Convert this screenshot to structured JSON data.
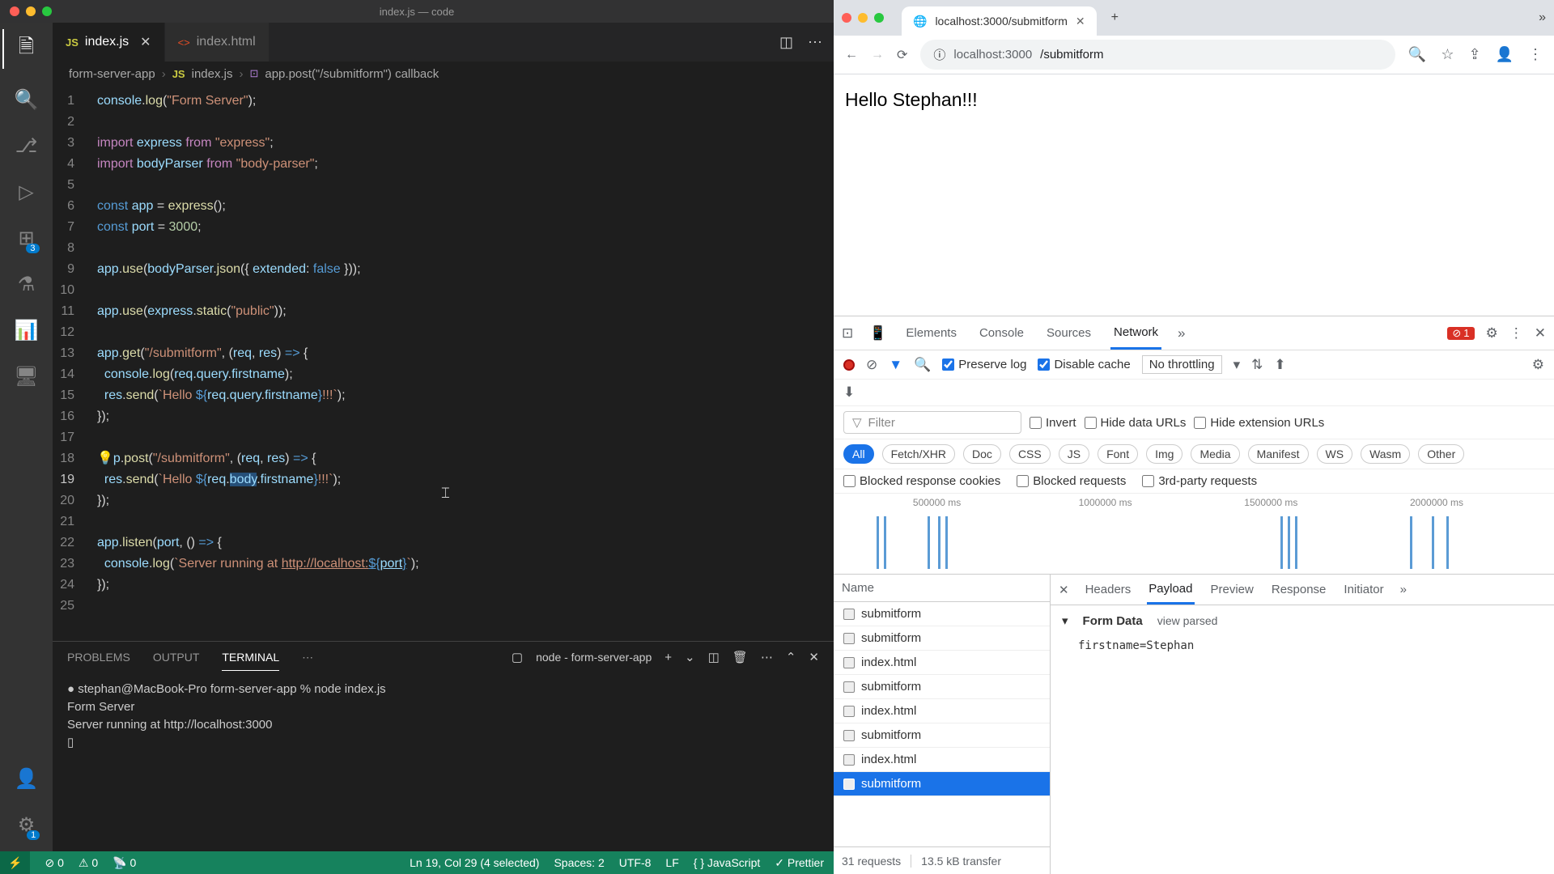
{
  "vscode": {
    "title": "index.js — code",
    "tabs": [
      {
        "icon": "JS",
        "label": "index.js",
        "active": true
      },
      {
        "icon": "<>",
        "label": "index.html",
        "active": false
      }
    ],
    "breadcrumbs": {
      "parts": [
        "form-server-app",
        "index.js",
        "app.post(\"/submitform\") callback"
      ]
    },
    "activity_badges": {
      "extensions": "3",
      "settings": "1"
    },
    "code": {
      "lines": [
        [
          {
            "t": "console",
            "c": "var"
          },
          {
            "t": ".",
            "c": "op"
          },
          {
            "t": "log",
            "c": "fn"
          },
          {
            "t": "(",
            "c": "op"
          },
          {
            "t": "\"Form Server\"",
            "c": "str"
          },
          {
            "t": ");",
            "c": "op"
          }
        ],
        [],
        [
          {
            "t": "import",
            "c": "kw"
          },
          {
            "t": " ",
            "c": ""
          },
          {
            "t": "express",
            "c": "var"
          },
          {
            "t": " ",
            "c": ""
          },
          {
            "t": "from",
            "c": "kw"
          },
          {
            "t": " ",
            "c": ""
          },
          {
            "t": "\"express\"",
            "c": "str"
          },
          {
            "t": ";",
            "c": "op"
          }
        ],
        [
          {
            "t": "import",
            "c": "kw"
          },
          {
            "t": " ",
            "c": ""
          },
          {
            "t": "bodyParser",
            "c": "var"
          },
          {
            "t": " ",
            "c": ""
          },
          {
            "t": "from",
            "c": "kw"
          },
          {
            "t": " ",
            "c": ""
          },
          {
            "t": "\"body-parser\"",
            "c": "str"
          },
          {
            "t": ";",
            "c": "op"
          }
        ],
        [],
        [
          {
            "t": "const",
            "c": "const"
          },
          {
            "t": " ",
            "c": ""
          },
          {
            "t": "app",
            "c": "prop"
          },
          {
            "t": " = ",
            "c": "op"
          },
          {
            "t": "express",
            "c": "fn"
          },
          {
            "t": "();",
            "c": "op"
          }
        ],
        [
          {
            "t": "const",
            "c": "const"
          },
          {
            "t": " ",
            "c": ""
          },
          {
            "t": "port",
            "c": "prop"
          },
          {
            "t": " = ",
            "c": "op"
          },
          {
            "t": "3000",
            "c": "num"
          },
          {
            "t": ";",
            "c": "op"
          }
        ],
        [],
        [
          {
            "t": "app",
            "c": "var"
          },
          {
            "t": ".",
            "c": "op"
          },
          {
            "t": "use",
            "c": "fn"
          },
          {
            "t": "(",
            "c": "op"
          },
          {
            "t": "bodyParser",
            "c": "var"
          },
          {
            "t": ".",
            "c": "op"
          },
          {
            "t": "json",
            "c": "fn"
          },
          {
            "t": "({ ",
            "c": "op"
          },
          {
            "t": "extended",
            "c": "var"
          },
          {
            "t": ": ",
            "c": "op"
          },
          {
            "t": "false",
            "c": "bool"
          },
          {
            "t": " }));",
            "c": "op"
          }
        ],
        [],
        [
          {
            "t": "app",
            "c": "var"
          },
          {
            "t": ".",
            "c": "op"
          },
          {
            "t": "use",
            "c": "fn"
          },
          {
            "t": "(",
            "c": "op"
          },
          {
            "t": "express",
            "c": "var"
          },
          {
            "t": ".",
            "c": "op"
          },
          {
            "t": "static",
            "c": "fn"
          },
          {
            "t": "(",
            "c": "op"
          },
          {
            "t": "\"public\"",
            "c": "str"
          },
          {
            "t": "));",
            "c": "op"
          }
        ],
        [],
        [
          {
            "t": "app",
            "c": "var"
          },
          {
            "t": ".",
            "c": "op"
          },
          {
            "t": "get",
            "c": "fn"
          },
          {
            "t": "(",
            "c": "op"
          },
          {
            "t": "\"/submitform\"",
            "c": "str"
          },
          {
            "t": ", (",
            "c": "op"
          },
          {
            "t": "req",
            "c": "var"
          },
          {
            "t": ", ",
            "c": "op"
          },
          {
            "t": "res",
            "c": "var"
          },
          {
            "t": ") ",
            "c": "op"
          },
          {
            "t": "=>",
            "c": "const"
          },
          {
            "t": " {",
            "c": "op"
          }
        ],
        [
          {
            "t": "  ",
            "c": ""
          },
          {
            "t": "console",
            "c": "var"
          },
          {
            "t": ".",
            "c": "op"
          },
          {
            "t": "log",
            "c": "fn"
          },
          {
            "t": "(",
            "c": "op"
          },
          {
            "t": "req",
            "c": "var"
          },
          {
            "t": ".",
            "c": "op"
          },
          {
            "t": "query",
            "c": "var"
          },
          {
            "t": ".",
            "c": "op"
          },
          {
            "t": "firstname",
            "c": "var"
          },
          {
            "t": ");",
            "c": "op"
          }
        ],
        [
          {
            "t": "  ",
            "c": ""
          },
          {
            "t": "res",
            "c": "var"
          },
          {
            "t": ".",
            "c": "op"
          },
          {
            "t": "send",
            "c": "fn"
          },
          {
            "t": "(",
            "c": "op"
          },
          {
            "t": "`Hello ",
            "c": "str"
          },
          {
            "t": "${",
            "c": "const"
          },
          {
            "t": "req",
            "c": "var"
          },
          {
            "t": ".",
            "c": "op"
          },
          {
            "t": "query",
            "c": "var"
          },
          {
            "t": ".",
            "c": "op"
          },
          {
            "t": "firstname",
            "c": "var"
          },
          {
            "t": "}",
            "c": "const"
          },
          {
            "t": "!!!`",
            "c": "str"
          },
          {
            "t": ");",
            "c": "op"
          }
        ],
        [
          {
            "t": "});",
            "c": "op"
          }
        ],
        [],
        [
          {
            "t": "💡",
            "c": "bulb"
          },
          {
            "t": "p",
            "c": "var"
          },
          {
            "t": ".",
            "c": "op"
          },
          {
            "t": "post",
            "c": "fn"
          },
          {
            "t": "(",
            "c": "op"
          },
          {
            "t": "\"/submitform\"",
            "c": "str"
          },
          {
            "t": ", (",
            "c": "op"
          },
          {
            "t": "req",
            "c": "var"
          },
          {
            "t": ", ",
            "c": "op"
          },
          {
            "t": "res",
            "c": "var"
          },
          {
            "t": ") ",
            "c": "op"
          },
          {
            "t": "=>",
            "c": "const"
          },
          {
            "t": " {",
            "c": "op"
          }
        ],
        [
          {
            "t": "  ",
            "c": ""
          },
          {
            "t": "res",
            "c": "var"
          },
          {
            "t": ".",
            "c": "op"
          },
          {
            "t": "send",
            "c": "fn"
          },
          {
            "t": "(",
            "c": "op"
          },
          {
            "t": "`Hello ",
            "c": "str"
          },
          {
            "t": "${",
            "c": "const"
          },
          {
            "t": "req",
            "c": "var"
          },
          {
            "t": ".",
            "c": "op"
          },
          {
            "t": "body",
            "c": "var sel"
          },
          {
            "t": ".",
            "c": "op"
          },
          {
            "t": "firstname",
            "c": "var"
          },
          {
            "t": "}",
            "c": "const"
          },
          {
            "t": "!!!`",
            "c": "str"
          },
          {
            "t": ");",
            "c": "op"
          }
        ],
        [
          {
            "t": "});",
            "c": "op"
          }
        ],
        [],
        [
          {
            "t": "app",
            "c": "var"
          },
          {
            "t": ".",
            "c": "op"
          },
          {
            "t": "listen",
            "c": "fn"
          },
          {
            "t": "(",
            "c": "op"
          },
          {
            "t": "port",
            "c": "var"
          },
          {
            "t": ", () ",
            "c": "op"
          },
          {
            "t": "=>",
            "c": "const"
          },
          {
            "t": " {",
            "c": "op"
          }
        ],
        [
          {
            "t": "  ",
            "c": ""
          },
          {
            "t": "console",
            "c": "var"
          },
          {
            "t": ".",
            "c": "op"
          },
          {
            "t": "log",
            "c": "fn"
          },
          {
            "t": "(",
            "c": "op"
          },
          {
            "t": "`Server running at ",
            "c": "str"
          },
          {
            "t": "http://localhost:",
            "c": "str url"
          },
          {
            "t": "${",
            "c": "const url"
          },
          {
            "t": "port",
            "c": "var url"
          },
          {
            "t": "}",
            "c": "const url"
          },
          {
            "t": "`",
            "c": "str"
          },
          {
            "t": ");",
            "c": "op"
          }
        ],
        [
          {
            "t": "});",
            "c": "op"
          }
        ],
        []
      ],
      "active_line": 19
    },
    "terminal": {
      "tabs": [
        "PROBLEMS",
        "OUTPUT",
        "TERMINAL"
      ],
      "active_tab": "TERMINAL",
      "task": "node - form-server-app",
      "prompt": "stephan@MacBook-Pro form-server-app %",
      "command": "node index.js",
      "output": [
        "Form Server",
        "Server running at http://localhost:3000",
        "▯"
      ]
    },
    "status_bar": {
      "errors": "0",
      "warnings": "0",
      "ports": "0",
      "selection": "Ln 19, Col 29 (4 selected)",
      "spaces": "Spaces: 2",
      "encoding": "UTF-8",
      "eol": "LF",
      "lang": "JavaScript",
      "prettier": "Prettier"
    }
  },
  "browser": {
    "tab": {
      "title": "localhost:3000/submitform"
    },
    "url": {
      "host": "localhost:3000",
      "path": "/submitform"
    },
    "page_text": "Hello Stephan!!!"
  },
  "devtools": {
    "tabs": [
      "Elements",
      "Console",
      "Sources",
      "Network"
    ],
    "active_tab": "Network",
    "error_count": "1",
    "preserve_log": true,
    "disable_cache": true,
    "throttling": "No throttling",
    "filter_placeholder": "Filter",
    "invert": false,
    "hide_data_urls": false,
    "hide_ext_urls": false,
    "filter_types": [
      "All",
      "Fetch/XHR",
      "Doc",
      "CSS",
      "JS",
      "Font",
      "Img",
      "Media",
      "Manifest",
      "WS",
      "Wasm",
      "Other"
    ],
    "active_filter": "All",
    "blocked_cookies": false,
    "blocked_requests": false,
    "third_party": false,
    "timeline_labels": [
      "500000 ms",
      "1000000 ms",
      "1500000 ms",
      "2000000 ms"
    ],
    "requests_header": "Name",
    "requests": [
      "submitform",
      "submitform",
      "index.html",
      "submitform",
      "index.html",
      "submitform",
      "index.html",
      "submitform"
    ],
    "selected_request_index": 7,
    "footer": {
      "count": "31 requests",
      "transfer": "13.5 kB transfer"
    },
    "detail_tabs": [
      "Headers",
      "Payload",
      "Preview",
      "Response",
      "Initiator"
    ],
    "active_detail_tab": "Payload",
    "form_data_label": "Form Data",
    "view_parsed": "view parsed",
    "form_data_kv": "firstname=Stephan"
  }
}
